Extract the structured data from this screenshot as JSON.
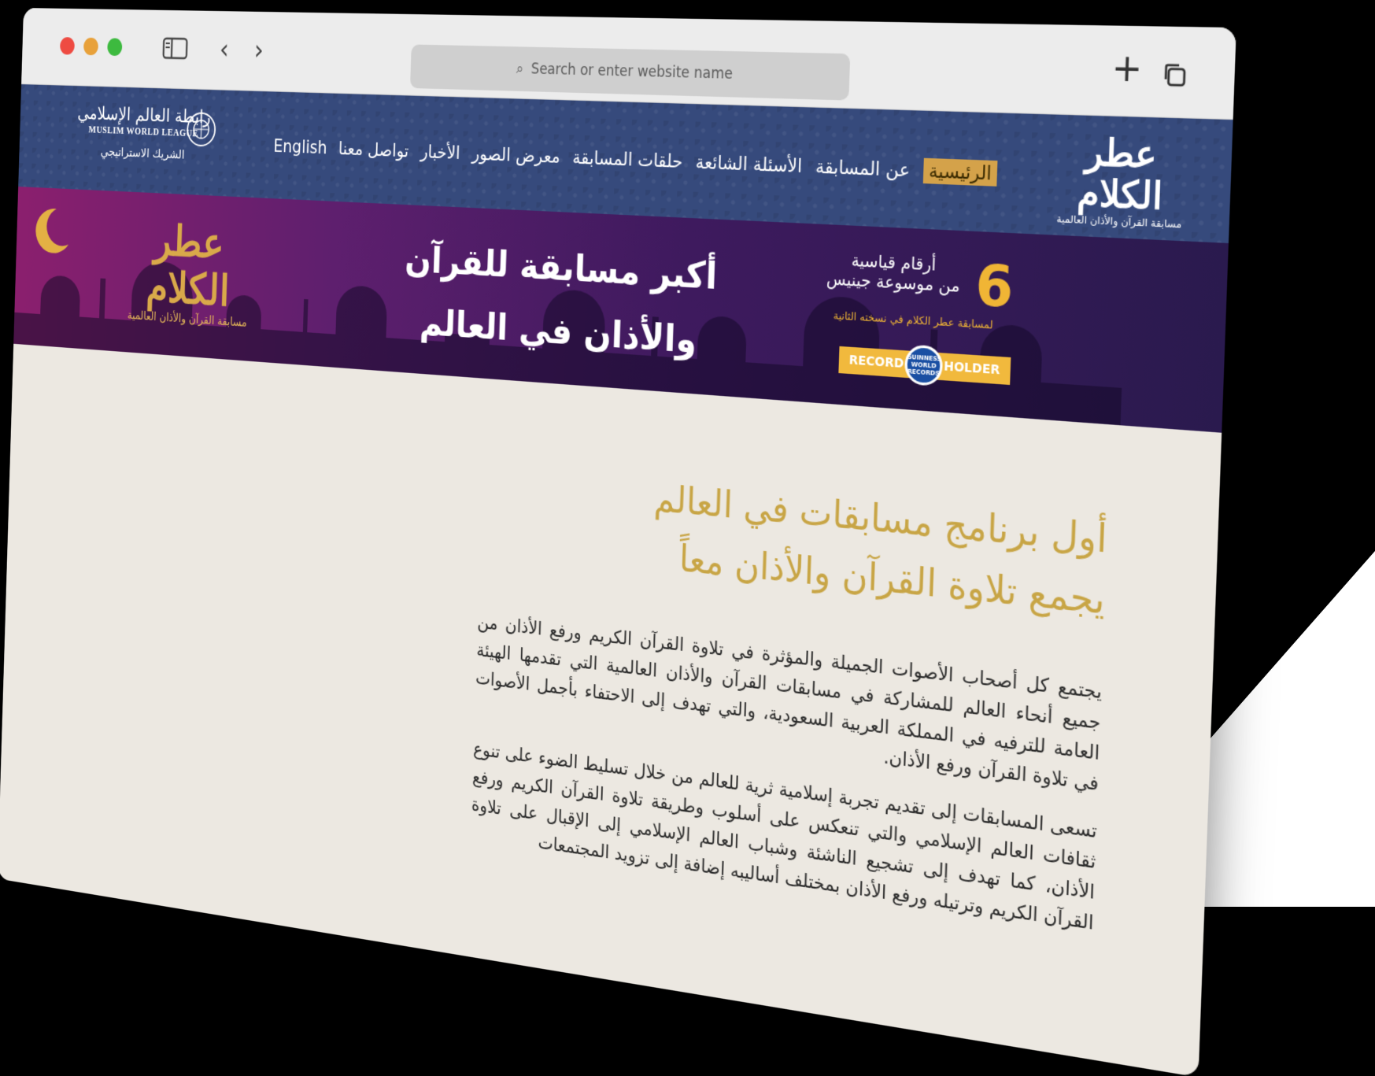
{
  "browser": {
    "address_placeholder": "Search or enter website name"
  },
  "partner": {
    "arabic_name": "رابطة العالم الإسلامي",
    "english_name": "MUSLIM WORLD LEAGUE",
    "label": "الشريك الاستراتيجي"
  },
  "nav": {
    "items": [
      "English",
      "تواصل معنا",
      "الأخبار",
      "معرض الصور",
      "حلقات المسابقة",
      "الأسئلة الشائعة",
      "عن المسابقة",
      "الرئيسية"
    ],
    "active": "الرئيسية"
  },
  "logo": {
    "title_line1": "عطر",
    "title_line2": "الكلام",
    "subtitle": "مسابقة القرآن والأذان العالمية"
  },
  "banner": {
    "title_line1": "أكبر مسابقة للقرآن",
    "title_line2": "والأذان في العالم",
    "records_number": "6",
    "records_line1": "أرقام قياسية",
    "records_line2": "من موسوعة جينيس",
    "records_line3": "لمسابقة عطر الكلام في نسخته الثانية",
    "gw_left": "RECORD",
    "gw_right": "HOLDER",
    "gw_seal": "GUINNESS WORLD RECORDS"
  },
  "main": {
    "headline_line1": "أول برنامج مسابقات في العالم",
    "headline_line2": "يجمع تلاوة القرآن والأذان معاً",
    "paragraph1": "يجتمع كل أصحاب الأصوات الجميلة والمؤثرة في تلاوة القرآن الكريم ورفع الأذان من جميع أنحاء العالم للمشاركة في مسابقات القرآن والأذان العالمية التي تقدمها الهيئة العامة للترفيه في المملكة العربية السعودية، والتي تهدف إلى الاحتفاء بأجمل الأصوات في تلاوة القرآن ورفع الأذان.",
    "paragraph2": "تسعى المسابقات إلى تقديم تجربة إسلامية ثرية للعالم من خلال تسليط الضوء على تنوع ثقافات العالم الإسلامي والتي تنعكس على أسلوب وطريقة تلاوة القرآن الكريم ورفع الأذان، كما تهدف إلى تشجيع الناشئة وشباب العالم الإسلامي إلى الإقبال على تلاوة القرآن الكريم وترتيله ورفع الأذان بمختلف أساليبه إضافة إلى تزويد المجتمعات"
  },
  "colors": {
    "header_bg": "#364a7c",
    "gold": "#c8a545",
    "nav_active": "#d4a24a",
    "page_bg": "#ece8e1"
  }
}
